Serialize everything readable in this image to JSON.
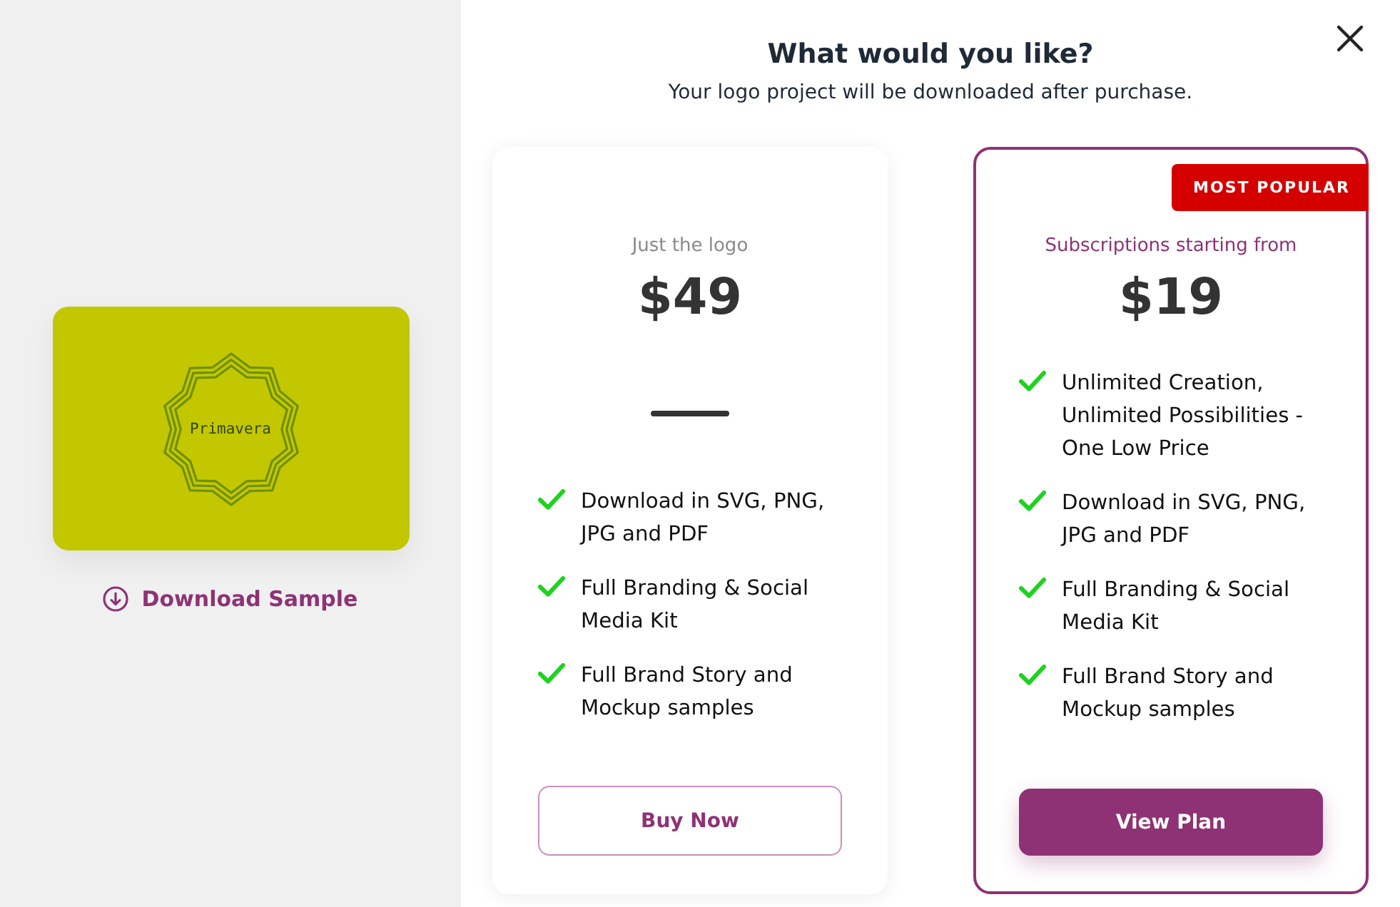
{
  "preview": {
    "logo_text": "Primavera",
    "download_link": "Download Sample"
  },
  "header": {
    "title": "What would you like?",
    "subtitle": "Your logo project will be downloaded after purchase."
  },
  "plans": [
    {
      "kind": "one-time",
      "highlighted": false,
      "subtitle": "Just the logo",
      "price": "$49",
      "features": [
        "Download in SVG, PNG, JPG and PDF",
        "Full Branding & Social Media Kit",
        "Full Brand Story and Mockup samples"
      ],
      "button": "Buy Now"
    },
    {
      "kind": "subscription",
      "highlighted": true,
      "badge": "MOST POPULAR",
      "subtitle": "Subscriptions starting from",
      "price": "$19",
      "features": [
        "Unlimited Creation, Unlimited Possibilities - One Low Price",
        "Download in SVG, PNG, JPG and PDF",
        "Full Branding & Social Media Kit",
        "Full Brand Story and Mockup samples"
      ],
      "button": "View Plan"
    }
  ]
}
